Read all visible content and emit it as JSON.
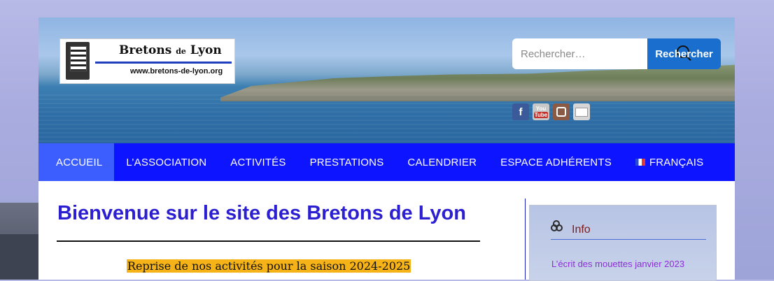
{
  "site": {
    "logo_title": "Bretons",
    "logo_title_small": "de",
    "logo_title_end": "Lyon",
    "logo_url": "www.bretons-de-lyon.org"
  },
  "search": {
    "placeholder": "Rechercher…",
    "button_label": "Rechercher"
  },
  "social": [
    "facebook-icon",
    "youtube-icon",
    "instagram-icon",
    "email-icon"
  ],
  "social_youtube_text": "You",
  "social_youtube_text2": "Tube",
  "nav": {
    "items": [
      {
        "label": "ACCUEIL",
        "active": true
      },
      {
        "label": "L’ASSOCIATION"
      },
      {
        "label": "ACTIVITÉS"
      },
      {
        "label": "PRESTATIONS"
      },
      {
        "label": "CALENDRIER"
      },
      {
        "label": "ESPACE ADHÉRENTS"
      },
      {
        "label": "FRANÇAIS"
      }
    ]
  },
  "main": {
    "title": "Bienvenue sur le site des Bretons de Lyon",
    "highlight": "Reprise de nos activités pour la saison 2024-2025"
  },
  "sidebar": {
    "widget_title": "Info",
    "widget_link": "L’écrit des mouettes janvier 2023"
  },
  "colors": {
    "nav_bg": "#0d14ff",
    "nav_active": "#3c5eff",
    "title": "#2b1fd1",
    "search_button": "#1a6fce",
    "highlight": "#f5b318"
  }
}
